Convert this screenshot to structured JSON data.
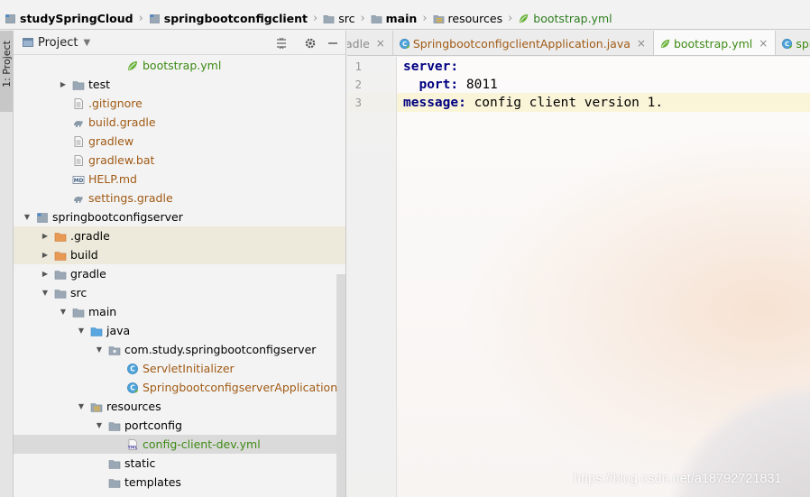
{
  "breadcrumb": [
    {
      "label": "studySpringCloud",
      "icon": "module-icon",
      "style": "bold"
    },
    {
      "label": "springbootconfigclient",
      "icon": "module-icon",
      "style": "bold"
    },
    {
      "label": "src",
      "icon": "folder-icon",
      "style": "normal"
    },
    {
      "label": "main",
      "icon": "folder-icon",
      "style": "bold"
    },
    {
      "label": "resources",
      "icon": "resources-folder-icon",
      "style": "normal"
    },
    {
      "label": "bootstrap.yml",
      "icon": "spring-leaf-icon",
      "style": "green"
    }
  ],
  "tool_strip": {
    "project_label": "1: Project"
  },
  "project_panel": {
    "title": "Project",
    "tools": [
      "collapse-icon",
      "gear-icon",
      "hide-icon"
    ]
  },
  "tree": [
    {
      "depth": 5,
      "arrow": "",
      "icon": "spring-leaf-icon",
      "label": "bootstrap.yml",
      "color": "green"
    },
    {
      "depth": 2,
      "arrow": "right",
      "icon": "folder-icon",
      "label": "test",
      "color": "black"
    },
    {
      "depth": 2,
      "arrow": "",
      "icon": "file-icon",
      "label": ".gitignore",
      "color": "brown"
    },
    {
      "depth": 2,
      "arrow": "",
      "icon": "gradle-icon",
      "label": "build.gradle",
      "color": "brown"
    },
    {
      "depth": 2,
      "arrow": "",
      "icon": "file-icon",
      "label": "gradlew",
      "color": "brown"
    },
    {
      "depth": 2,
      "arrow": "",
      "icon": "file-icon",
      "label": "gradlew.bat",
      "color": "brown"
    },
    {
      "depth": 2,
      "arrow": "",
      "icon": "markdown-icon",
      "label": "HELP.md",
      "color": "brown"
    },
    {
      "depth": 2,
      "arrow": "",
      "icon": "gradle-icon",
      "label": "settings.gradle",
      "color": "brown"
    },
    {
      "depth": 0,
      "arrow": "down",
      "icon": "module-icon",
      "label": "springbootconfigserver",
      "color": "black"
    },
    {
      "depth": 1,
      "arrow": "right",
      "icon": "orange-folder-icon",
      "label": ".gradle",
      "color": "black",
      "hl": true
    },
    {
      "depth": 1,
      "arrow": "right",
      "icon": "orange-folder-icon",
      "label": "build",
      "color": "black",
      "hl": true
    },
    {
      "depth": 1,
      "arrow": "right",
      "icon": "folder-icon",
      "label": "gradle",
      "color": "black"
    },
    {
      "depth": 1,
      "arrow": "down",
      "icon": "folder-icon",
      "label": "src",
      "color": "black"
    },
    {
      "depth": 2,
      "arrow": "down",
      "icon": "folder-icon",
      "label": "main",
      "color": "black"
    },
    {
      "depth": 3,
      "arrow": "down",
      "icon": "blue-folder-icon",
      "label": "java",
      "color": "black"
    },
    {
      "depth": 4,
      "arrow": "down",
      "icon": "package-icon",
      "label": "com.study.springbootconfigserver",
      "color": "black"
    },
    {
      "depth": 5,
      "arrow": "",
      "icon": "class-icon",
      "label": "ServletInitializer",
      "color": "brown"
    },
    {
      "depth": 5,
      "arrow": "",
      "icon": "spring-class-icon",
      "label": "SpringbootconfigserverApplication",
      "color": "brown"
    },
    {
      "depth": 3,
      "arrow": "down",
      "icon": "resources-folder-icon",
      "label": "resources",
      "color": "black"
    },
    {
      "depth": 4,
      "arrow": "down",
      "icon": "folder-icon",
      "label": "portconfig",
      "color": "black"
    },
    {
      "depth": 5,
      "arrow": "",
      "icon": "yml-icon",
      "label": "config-client-dev.yml",
      "color": "green",
      "sel": true
    },
    {
      "depth": 4,
      "arrow": "",
      "icon": "folder-icon",
      "label": "static",
      "color": "black"
    },
    {
      "depth": 4,
      "arrow": "",
      "icon": "folder-icon",
      "label": "templates",
      "color": "black"
    }
  ],
  "tabs": [
    {
      "label": "adle",
      "icon": "",
      "clip": true,
      "active": false,
      "color": "#8c8c8c"
    },
    {
      "label": "SpringbootconfigclientApplication.java",
      "icon": "spring-class-icon",
      "clip": false,
      "active": false,
      "color": "#a05a14"
    },
    {
      "label": "bootstrap.yml",
      "icon": "spring-leaf-icon",
      "clip": false,
      "active": true,
      "color": "#3e8a14"
    },
    {
      "label": "springb",
      "icon": "spring-class-icon",
      "clip": true,
      "active": false,
      "color": "#3e8a14"
    }
  ],
  "editor": {
    "line_numbers": [
      "1",
      "2",
      "3"
    ],
    "lines": [
      {
        "key": "server",
        "sep": ":",
        "value": "",
        "indent": ""
      },
      {
        "key": "port",
        "sep": ": ",
        "value": "8011",
        "indent": "  "
      },
      {
        "key": "message",
        "sep": ": ",
        "value": "config client version 1.",
        "indent": ""
      }
    ],
    "current_line": 3
  },
  "watermark": "https://blog.csdn.net/a18792721831",
  "colors": {
    "key": "#000080",
    "green_file": "#3e8a14",
    "brown_file": "#a05a14",
    "highlight_row": "#edeadb"
  }
}
